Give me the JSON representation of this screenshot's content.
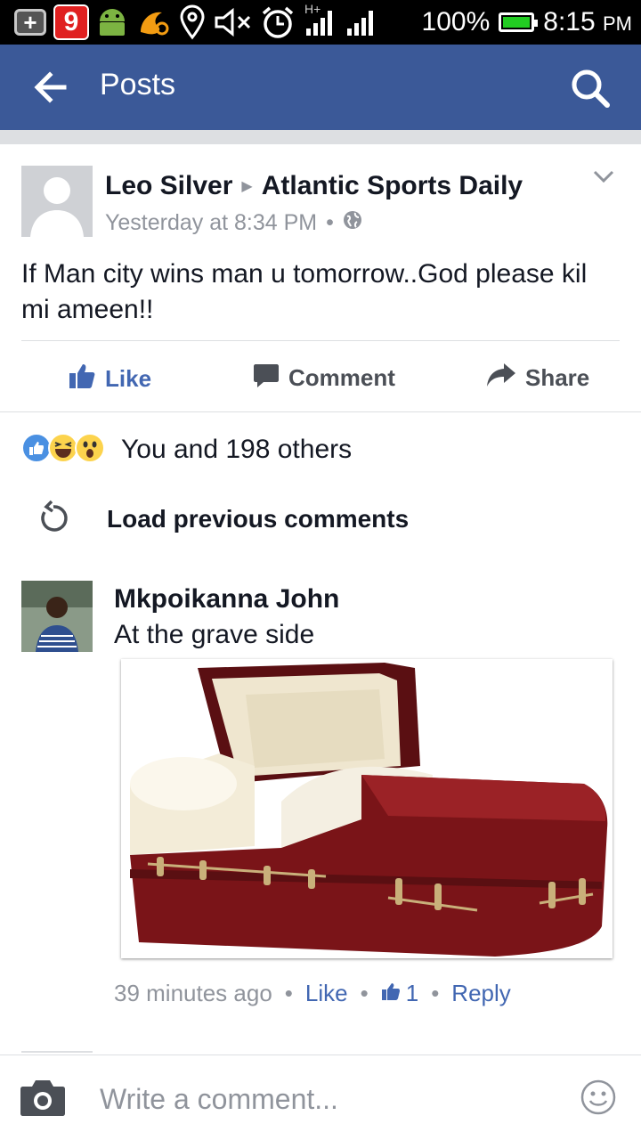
{
  "status_bar": {
    "notification_nine": "9",
    "network_label": "H+",
    "battery_percent": "100%",
    "time": "8:15",
    "time_suffix": "PM"
  },
  "app_bar": {
    "title": "Posts"
  },
  "post": {
    "author": "Leo Silver",
    "target": "Atlantic Sports Daily",
    "timestamp": "Yesterday at 8:34 PM",
    "separator": "•",
    "text": "If Man city wins man u tomorrow..God please kil mi ameen!!"
  },
  "actions": {
    "like": "Like",
    "comment": "Comment",
    "share": "Share"
  },
  "reactions": {
    "summary": "You and 198 others"
  },
  "load_previous": "Load previous comments",
  "comment": {
    "author": "Mkpoikanna John",
    "text": "At the grave side",
    "time": "39 minutes ago",
    "like_label": "Like",
    "like_count": "1",
    "reply_label": "Reply",
    "dot": "•"
  },
  "composer": {
    "placeholder": "Write a comment..."
  },
  "colors": {
    "brand": "#3b5998",
    "link": "#4267b2"
  }
}
